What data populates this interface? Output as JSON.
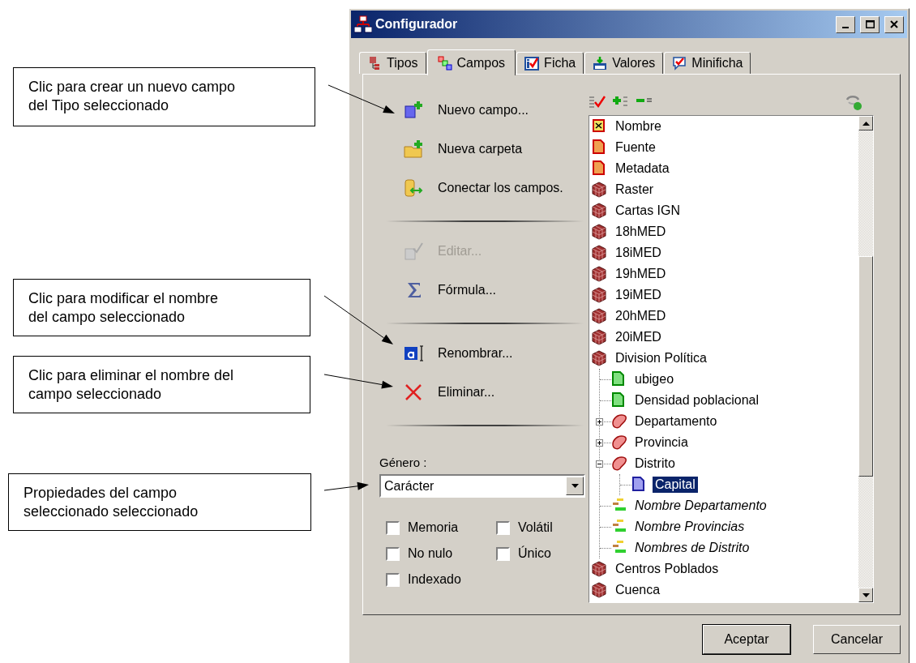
{
  "callouts": [
    {
      "text": "Clic para crear un nuevo campo del Tipo seleccionado"
    },
    {
      "text": "Clic para modificar el nombre del campo seleccionado"
    },
    {
      "text": "Clic para eliminar el nombre del campo seleccionado"
    },
    {
      "text": "Propiedades del campo seleccionado seleccionado"
    }
  ],
  "window": {
    "title": "Configurador"
  },
  "tabs": [
    {
      "label": "Tipos",
      "kind": "tipos",
      "selected": false
    },
    {
      "label": "Campos",
      "kind": "campos",
      "selected": true
    },
    {
      "label": "Ficha",
      "kind": "ficha",
      "selected": false
    },
    {
      "label": "Valores",
      "kind": "valores",
      "selected": false
    },
    {
      "label": "Minificha",
      "kind": "minificha",
      "selected": false
    }
  ],
  "action_groups": [
    {
      "items": [
        {
          "label": "Nuevo campo...",
          "kind": "new-field",
          "disabled": false
        },
        {
          "label": "Nueva carpeta",
          "kind": "new-folder",
          "disabled": false
        },
        {
          "label": "Conectar los campos.",
          "kind": "connect",
          "disabled": false
        }
      ]
    },
    {
      "items": [
        {
          "label": "Editar...",
          "kind": "edit",
          "disabled": true
        },
        {
          "label": "Fórmula...",
          "kind": "formula",
          "disabled": false
        }
      ]
    },
    {
      "items": [
        {
          "label": "Renombrar...",
          "kind": "rename",
          "disabled": false
        },
        {
          "label": "Eliminar...",
          "kind": "delete",
          "disabled": false
        }
      ]
    }
  ],
  "genero": {
    "label": "Género :",
    "value": "Carácter"
  },
  "options": [
    {
      "label": "Memoria",
      "checked": false
    },
    {
      "label": "Volátil",
      "checked": false
    },
    {
      "label": "No nulo",
      "checked": false
    },
    {
      "label": "Único",
      "checked": false
    },
    {
      "label": "Indexado",
      "checked": false
    }
  ],
  "tree": [
    {
      "label": "Nombre",
      "kind": "key",
      "selected": false
    },
    {
      "label": "Fuente",
      "kind": "doc-red",
      "selected": false
    },
    {
      "label": "Metadata",
      "kind": "doc-red",
      "selected": false
    },
    {
      "label": "Raster",
      "kind": "cube",
      "selected": false
    },
    {
      "label": "Cartas IGN",
      "kind": "cube",
      "selected": false
    },
    {
      "label": "18hMED",
      "kind": "cube",
      "selected": false
    },
    {
      "label": "18iMED",
      "kind": "cube",
      "selected": false
    },
    {
      "label": "19hMED",
      "kind": "cube",
      "selected": false
    },
    {
      "label": "19iMED",
      "kind": "cube",
      "selected": false
    },
    {
      "label": "20hMED",
      "kind": "cube",
      "selected": false
    },
    {
      "label": "20iMED",
      "kind": "cube",
      "selected": false
    },
    {
      "label": "Division Política",
      "kind": "cube",
      "selected": false,
      "children": [
        {
          "label": "ubigeo",
          "kind": "doc-green",
          "selected": false
        },
        {
          "label": "Densidad poblacional",
          "kind": "doc-green",
          "selected": false
        },
        {
          "label": "Departamento",
          "kind": "region",
          "selected": false,
          "expanded": false
        },
        {
          "label": "Provincia",
          "kind": "region",
          "selected": false,
          "expanded": false
        },
        {
          "label": "Distrito",
          "kind": "region",
          "selected": false,
          "expanded": true,
          "children": [
            {
              "label": "Capital",
              "kind": "doc-blue",
              "selected": true
            }
          ]
        },
        {
          "label": "Nombre Departamento",
          "kind": "alias",
          "selected": false
        },
        {
          "label": "Nombre Provincias",
          "kind": "alias",
          "selected": false
        },
        {
          "label": "Nombres de Distrito",
          "kind": "alias",
          "selected": false
        }
      ]
    },
    {
      "label": "Centros Poblados",
      "kind": "cube",
      "selected": false
    },
    {
      "label": "Cuenca",
      "kind": "cube",
      "selected": false
    }
  ],
  "buttons": [
    {
      "label": "Aceptar",
      "kind": "default"
    },
    {
      "label": "Cancelar",
      "kind": "normal"
    }
  ]
}
